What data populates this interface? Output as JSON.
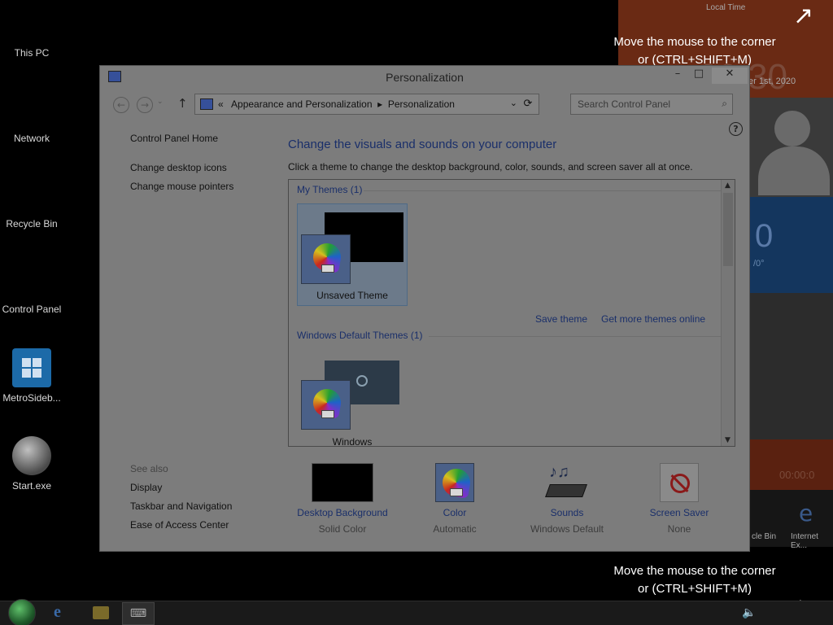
{
  "desktop": {
    "icons": [
      {
        "label": "This PC"
      },
      {
        "label": "Network"
      },
      {
        "label": "Recycle Bin"
      },
      {
        "label": "Control Panel"
      },
      {
        "label": "MetroSideb..."
      },
      {
        "label": "Start.exe"
      }
    ]
  },
  "sidebar": {
    "local_time_label": "Local Time",
    "clock": "00:30",
    "date_fragment": "er 1st, 2020",
    "blue_tile_value": "0",
    "blue_tile_sub": "/0°",
    "timer": "00:00:0",
    "bottom_tiles": [
      "cle Bin",
      "Internet Ex..."
    ]
  },
  "hints": {
    "top": {
      "line1": "Move the mouse to the corner",
      "line2": "or (CTRL+SHIFT+M)"
    },
    "bottom": {
      "line1": "Move the mouse to the corner",
      "line2": "or (CTRL+SHIFT+M)"
    }
  },
  "window": {
    "title": "Personalization",
    "controls": {
      "minimize": "–",
      "maximize": "□",
      "close": "✕"
    },
    "nav": {
      "back": "←",
      "forward": "→",
      "up": "↑",
      "address_prefix": "«",
      "breadcrumb_1": "Appearance and Personalization",
      "breadcrumb_sep": "▸",
      "breadcrumb_2": "Personalization",
      "dropdown": "⌄",
      "refresh": "⟳"
    },
    "search": {
      "placeholder": "Search Control Panel",
      "icon": "⌕"
    },
    "left_pane": {
      "home": "Control Panel Home",
      "links": [
        "Change desktop icons",
        "Change mouse pointers"
      ],
      "see_also_label": "See also",
      "see_also": [
        "Display",
        "Taskbar and Navigation",
        "Ease of Access Center"
      ]
    },
    "main": {
      "heading": "Change the visuals and sounds on your computer",
      "subheading": "Click a theme to change the desktop background, color, sounds, and screen saver all at once.",
      "help": "?",
      "groups": [
        {
          "title": "My Themes (1)",
          "themes": [
            {
              "name": "Unsaved Theme",
              "selected": true
            }
          ]
        },
        {
          "title": "Windows Default Themes (1)",
          "themes": [
            {
              "name": "Windows",
              "selected": false
            }
          ]
        }
      ],
      "save_theme": "Save theme",
      "get_more": "Get more themes online"
    },
    "bottom": [
      {
        "title": "Desktop Background",
        "value": "Solid Color",
        "icon": "desktop-background-icon"
      },
      {
        "title": "Color",
        "value": "Automatic",
        "icon": "color-icon"
      },
      {
        "title": "Sounds",
        "value": "Windows Default",
        "icon": "sounds-icon"
      },
      {
        "title": "Screen Saver",
        "value": "None",
        "icon": "screen-saver-icon"
      }
    ]
  },
  "colors": {
    "link": "#1a2f6a",
    "overlay_window": "#7c7c7c",
    "sidebar_orange": "#6a2a14",
    "sidebar_blue": "#14365e"
  }
}
